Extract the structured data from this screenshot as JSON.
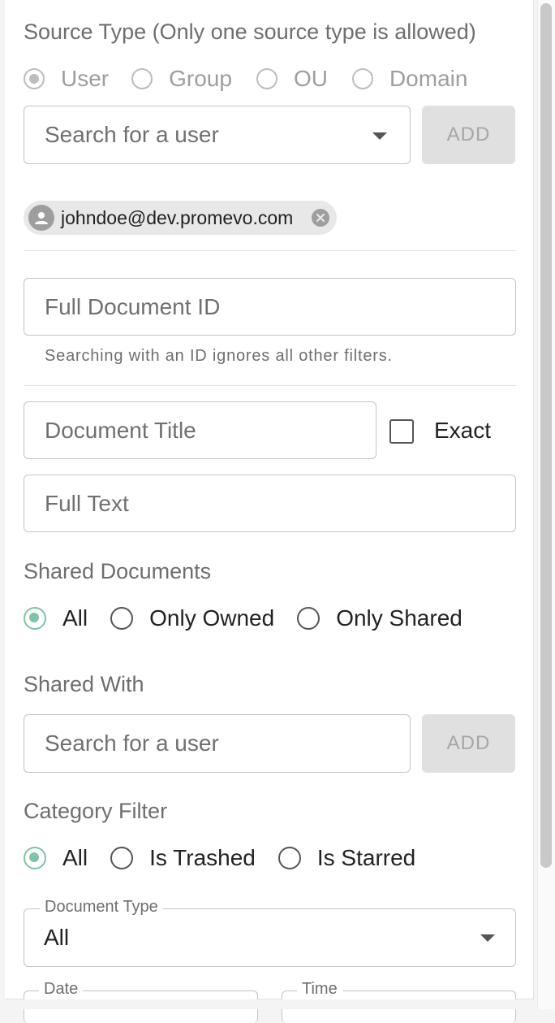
{
  "source_type": {
    "label": "Source Type (Only one source type is allowed)",
    "options": [
      {
        "label": "User",
        "selected": true
      },
      {
        "label": "Group",
        "selected": false
      },
      {
        "label": "OU",
        "selected": false
      },
      {
        "label": "Domain",
        "selected": false
      }
    ],
    "search_placeholder": "Search for a user",
    "add_label": "ADD",
    "chip": {
      "value": "johndoe@dev.promevo.com",
      "icon": "person-icon",
      "remove_icon": "close-circle-icon"
    }
  },
  "document_id": {
    "placeholder": "Full Document ID",
    "helper": "Searching with an ID ignores all other filters."
  },
  "document_title": {
    "placeholder": "Document Title",
    "exact_label": "Exact",
    "exact_checked": false
  },
  "full_text": {
    "placeholder": "Full Text"
  },
  "shared_documents": {
    "label": "Shared Documents",
    "options": [
      {
        "label": "All",
        "selected": true
      },
      {
        "label": "Only Owned",
        "selected": false
      },
      {
        "label": "Only Shared",
        "selected": false
      }
    ]
  },
  "shared_with": {
    "label": "Shared With",
    "search_placeholder": "Search for a user",
    "add_label": "ADD"
  },
  "category_filter": {
    "label": "Category Filter",
    "options": [
      {
        "label": "All",
        "selected": true
      },
      {
        "label": "Is Trashed",
        "selected": false
      },
      {
        "label": "Is Starred",
        "selected": false
      }
    ]
  },
  "document_type": {
    "label": "Document Type",
    "value": "All"
  },
  "date": {
    "label": "Date"
  },
  "time": {
    "label": "Time"
  },
  "colors": {
    "accent": "#7cc5a5",
    "disabled": "#bdbdbd",
    "button_bg": "#e0e0e0"
  }
}
